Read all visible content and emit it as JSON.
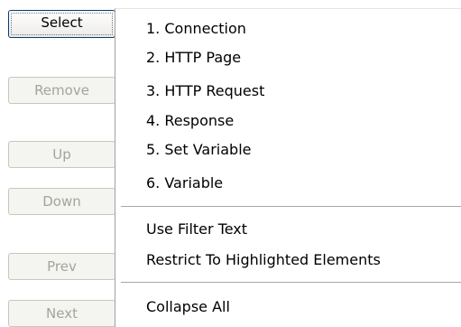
{
  "buttons": {
    "select": "Select",
    "remove": "Remove",
    "up": "Up",
    "down": "Down",
    "prev": "Prev",
    "next": "Next"
  },
  "menu": {
    "items": [
      "1. Connection",
      "2. HTTP Page",
      "3. HTTP Request",
      "4. Response",
      "5. Set Variable",
      "6. Variable"
    ],
    "options": [
      "Use Filter Text",
      "Restrict To Highlighted Elements"
    ],
    "actions": [
      "Collapse All"
    ]
  },
  "colors": {
    "disabled_text": "#a5a49a",
    "button_face": "#f4f4f0",
    "focused_border": "#003c74"
  }
}
